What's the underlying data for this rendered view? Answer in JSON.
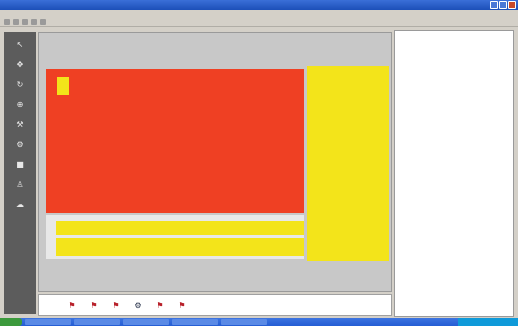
{
  "window": {
    "title": ""
  },
  "menu": {
    "items": [
      "",
      "",
      "",
      "",
      "",
      ""
    ]
  },
  "toolbar": {
    "label": ""
  },
  "palette": {
    "tools": [
      {
        "icon": "pointer-icon",
        "label": ""
      },
      {
        "icon": "move-icon",
        "label": ""
      },
      {
        "icon": "rotate-icon",
        "label": ""
      },
      {
        "icon": "zoom-icon",
        "label": ""
      },
      {
        "icon": "wrench-icon",
        "label": ""
      },
      {
        "icon": "gear-icon",
        "label": ""
      },
      {
        "icon": "block-icon",
        "label": ""
      },
      {
        "icon": "person-icon",
        "label": ""
      },
      {
        "icon": "cloud-icon",
        "label": ""
      }
    ]
  },
  "canvas": {
    "small_box_label": "",
    "red_label": "",
    "right_panel_label": "",
    "row1_left": "",
    "row1_right": "",
    "row2_label": "",
    "colors": {
      "red": "#ef4023",
      "yellow": "#f3e41a"
    }
  },
  "icon_row": {
    "lead": "",
    "items": [
      {
        "icon": "device-icon",
        "label": ""
      },
      {
        "icon": "device-icon",
        "label": ""
      },
      {
        "icon": "device-icon",
        "label": ""
      },
      {
        "icon": "gear-icon",
        "label": ""
      },
      {
        "icon": "device-icon",
        "label": ""
      },
      {
        "icon": "device-icon",
        "label": ""
      }
    ]
  },
  "properties": {
    "rows": [
      {
        "key": "",
        "value": "",
        "level": 0
      },
      {
        "key": "",
        "value": "",
        "level": 1
      },
      {
        "key": "",
        "value": "",
        "level": 1
      },
      {
        "key": "",
        "value": "",
        "level": 1
      },
      {
        "key": "",
        "value": "",
        "level": 2
      },
      {
        "key": "",
        "value": "",
        "level": 2
      },
      {
        "key": "",
        "value": "",
        "level": 2
      },
      {
        "key": "",
        "value": "",
        "level": 2
      },
      {
        "key": "",
        "value": "",
        "level": 1
      },
      {
        "key": "",
        "value": "",
        "level": 1
      },
      {
        "key": "",
        "value": "",
        "level": 0
      },
      {
        "key": "",
        "value": "",
        "level": 1
      },
      {
        "key": "",
        "value": "",
        "level": 2
      },
      {
        "key": "",
        "value": "",
        "level": 2
      },
      {
        "key": "",
        "value": "",
        "level": 2
      },
      {
        "key": "",
        "value": "",
        "level": 2
      },
      {
        "key": "",
        "value": "",
        "level": 2
      }
    ]
  },
  "taskbar": {
    "start_label": "",
    "time": ""
  }
}
